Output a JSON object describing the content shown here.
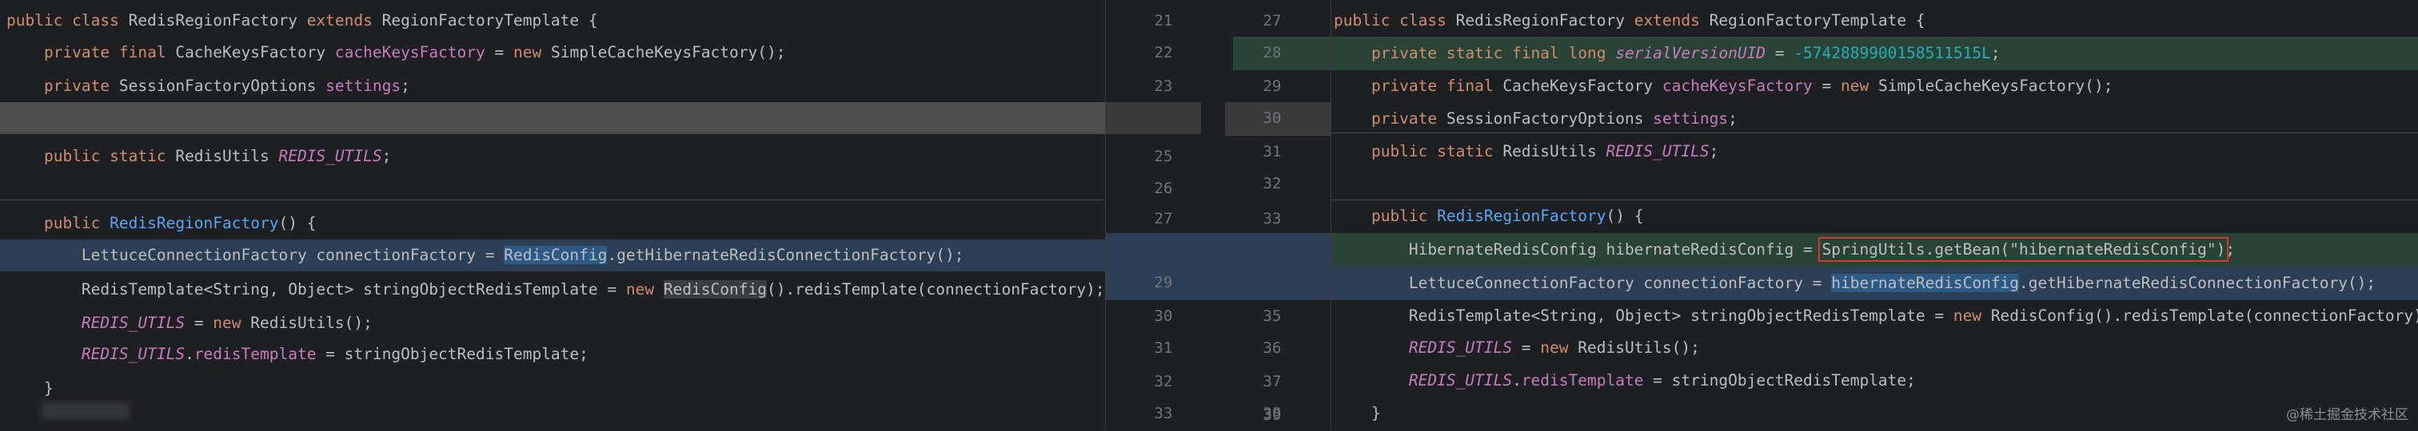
{
  "left_lines": [
    {
      "n": "",
      "type": "normal",
      "tokens": [
        {
          "t": "public class ",
          "c": "kw"
        },
        {
          "t": "RedisRegionFactory ",
          "c": ""
        },
        {
          "t": "extends ",
          "c": "kw"
        },
        {
          "t": "RegionFactoryTemplate {",
          "c": ""
        }
      ]
    },
    {
      "n": "22",
      "type": "normal",
      "tokens": [
        {
          "t": "    private final ",
          "c": "kw"
        },
        {
          "t": "CacheKeysFactory ",
          "c": ""
        },
        {
          "t": "cacheKeysFactory",
          "c": "fld"
        },
        {
          "t": " = ",
          "c": ""
        },
        {
          "t": "new ",
          "c": "kw"
        },
        {
          "t": "SimpleCacheKeysFactory();",
          "c": ""
        }
      ]
    },
    {
      "n": "23",
      "type": "normal",
      "tokens": [
        {
          "t": "    private ",
          "c": "kw"
        },
        {
          "t": "SessionFactoryOptions ",
          "c": ""
        },
        {
          "t": "settings",
          "c": "fld"
        },
        {
          "t": ";",
          "c": ""
        }
      ]
    },
    {
      "n": "",
      "type": "removed-ph",
      "tokens": []
    },
    {
      "n": "25",
      "type": "normal",
      "tokens": [
        {
          "t": "    public static ",
          "c": "kw"
        },
        {
          "t": "RedisUtils ",
          "c": ""
        },
        {
          "t": "REDIS_UTILS",
          "c": "sfld"
        },
        {
          "t": ";",
          "c": ""
        }
      ]
    },
    {
      "n": "26",
      "type": "normal",
      "tokens": []
    },
    {
      "n": "27",
      "type": "normal",
      "tokens": [
        {
          "t": "    public ",
          "c": "kw"
        },
        {
          "t": "RedisRegionFactory",
          "c": "fn"
        },
        {
          "t": "() {",
          "c": ""
        }
      ]
    },
    {
      "n": "",
      "type": "modified",
      "tokens": [
        {
          "t": "        LettuceConnectionFactory connectionFactory = ",
          "c": ""
        },
        {
          "t": "RedisConfig",
          "c": "hl"
        },
        {
          "t": ".getHibernateRedisConnectionFactory();",
          "c": ""
        }
      ]
    },
    {
      "n": "29",
      "type": "normal",
      "tokens": [
        {
          "t": "        RedisTemplate<String, Object> stringObjectRedisTemplate = ",
          "c": ""
        },
        {
          "t": "new ",
          "c": "kw"
        },
        {
          "t": "RedisConfig",
          "c": "hl2"
        },
        {
          "t": "().redisTemplate(connectionFactory);",
          "c": ""
        }
      ]
    },
    {
      "n": "30",
      "type": "normal",
      "tokens": [
        {
          "t": "        ",
          "c": ""
        },
        {
          "t": "REDIS_UTILS",
          "c": "sfld"
        },
        {
          "t": " = ",
          "c": ""
        },
        {
          "t": "new ",
          "c": "kw"
        },
        {
          "t": "RedisUtils();",
          "c": ""
        }
      ]
    },
    {
      "n": "31",
      "type": "normal",
      "tokens": [
        {
          "t": "        ",
          "c": ""
        },
        {
          "t": "REDIS_UTILS",
          "c": "sfld"
        },
        {
          "t": ".",
          "c": ""
        },
        {
          "t": "redisTemplate",
          "c": "fld"
        },
        {
          "t": " = stringObjectRedisTemplate;",
          "c": ""
        }
      ]
    },
    {
      "n": "32",
      "type": "normal",
      "tokens": [
        {
          "t": "    }",
          "c": ""
        }
      ]
    },
    {
      "n": "33",
      "type": "normal",
      "tokens": []
    }
  ],
  "left_numbers": [
    "21",
    "22",
    "23",
    "25",
    "26",
    "27",
    "29",
    "30",
    "31",
    "32",
    "33"
  ],
  "right_numbers": [
    "27",
    "28",
    "29",
    "30",
    "31",
    "32",
    "33",
    "35",
    "36",
    "37",
    "38",
    "39"
  ],
  "right_lines": [
    {
      "type": "normal",
      "tokens": [
        {
          "t": "public class ",
          "c": "kw"
        },
        {
          "t": "RedisRegionFactory ",
          "c": ""
        },
        {
          "t": "extends ",
          "c": "kw"
        },
        {
          "t": "RegionFactoryTemplate {",
          "c": ""
        }
      ]
    },
    {
      "type": "added",
      "tokens": [
        {
          "t": "    private static final long ",
          "c": "kw"
        },
        {
          "t": "serialVersionUID",
          "c": "sfinal"
        },
        {
          "t": " = ",
          "c": ""
        },
        {
          "t": "-5742889900158511515L",
          "c": "num"
        },
        {
          "t": ";",
          "c": ""
        }
      ]
    },
    {
      "type": "normal",
      "tokens": [
        {
          "t": "    private final ",
          "c": "kw"
        },
        {
          "t": "CacheKeysFactory ",
          "c": ""
        },
        {
          "t": "cacheKeysFactory",
          "c": "fld"
        },
        {
          "t": " = ",
          "c": ""
        },
        {
          "t": "new ",
          "c": "kw"
        },
        {
          "t": "SimpleCacheKeysFactory();",
          "c": ""
        }
      ]
    },
    {
      "type": "normal",
      "tokens": [
        {
          "t": "    private ",
          "c": "kw"
        },
        {
          "t": "SessionFactoryOptions ",
          "c": ""
        },
        {
          "t": "settings",
          "c": "fld"
        },
        {
          "t": ";",
          "c": ""
        }
      ]
    },
    {
      "type": "normal",
      "tokens": [
        {
          "t": "    public static ",
          "c": "kw"
        },
        {
          "t": "RedisUtils ",
          "c": ""
        },
        {
          "t": "REDIS_UTILS",
          "c": "sfld"
        },
        {
          "t": ";",
          "c": ""
        }
      ]
    },
    {
      "type": "normal",
      "tokens": []
    },
    {
      "type": "normal",
      "tokens": [
        {
          "t": "    public ",
          "c": "kw"
        },
        {
          "t": "RedisRegionFactory",
          "c": "fn"
        },
        {
          "t": "() {",
          "c": ""
        }
      ]
    },
    {
      "type": "added",
      "tokens": [
        {
          "t": "        HibernateRedisConfig hibernateRedisConfig = ",
          "c": ""
        },
        {
          "t": "SpringUtils.getBean(\"hibernateRedisConfig\")",
          "c": "redbox"
        },
        {
          "t": ";",
          "c": ""
        }
      ]
    },
    {
      "type": "modified",
      "tokens": [
        {
          "t": "        LettuceConnectionFactory connectionFactory = ",
          "c": ""
        },
        {
          "t": "hibernateRedisConfig",
          "c": "hl"
        },
        {
          "t": ".getHibernateRedisConnectionFactory();",
          "c": ""
        }
      ]
    },
    {
      "type": "normal",
      "tokens": [
        {
          "t": "        RedisTemplate<String, Object> stringObjectRedisTemplate = ",
          "c": ""
        },
        {
          "t": "new ",
          "c": "kw"
        },
        {
          "t": "RedisConfig().redisTemplate(connectionFactory);",
          "c": ""
        }
      ]
    },
    {
      "type": "normal",
      "tokens": [
        {
          "t": "        ",
          "c": ""
        },
        {
          "t": "REDIS_UTILS",
          "c": "sfld"
        },
        {
          "t": " = ",
          "c": ""
        },
        {
          "t": "new ",
          "c": "kw"
        },
        {
          "t": "RedisUtils();",
          "c": ""
        }
      ]
    },
    {
      "type": "normal",
      "tokens": [
        {
          "t": "        ",
          "c": ""
        },
        {
          "t": "REDIS_UTILS",
          "c": "sfld"
        },
        {
          "t": ".",
          "c": ""
        },
        {
          "t": "redisTemplate",
          "c": "fld"
        },
        {
          "t": " = stringObjectRedisTemplate;",
          "c": ""
        }
      ]
    },
    {
      "type": "normal",
      "tokens": [
        {
          "t": "    }",
          "c": ""
        }
      ]
    }
  ],
  "watermark": "@稀土掘金技术社区",
  "colors": {
    "added": "#294436",
    "modified": "#2c3f55",
    "highlight": "#2e5a86",
    "redbox": "#d8392f"
  }
}
